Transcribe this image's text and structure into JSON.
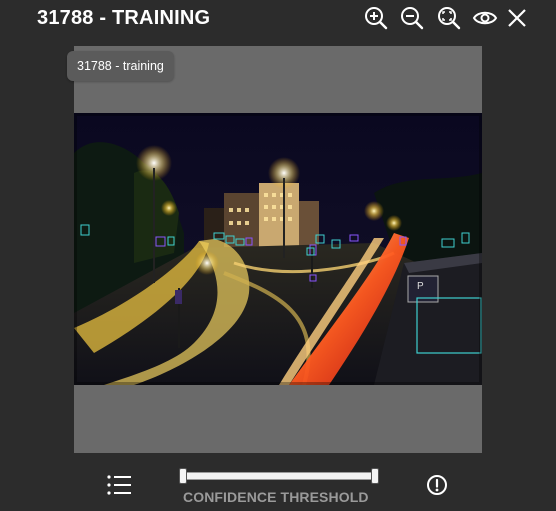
{
  "header": {
    "title": "31788 - TRAINING"
  },
  "toolbar": {
    "icons": [
      "zoom-in-icon",
      "zoom-out-icon",
      "zoom-reset-icon",
      "eye-icon",
      "close-icon"
    ]
  },
  "image": {
    "tooltip": "31788 - training"
  },
  "controls": {
    "slider_label": "CONFIDENCE THRESHOLD",
    "slider_low": 0,
    "slider_high": 1,
    "list_icon": "list-icon",
    "alert_icon": "alert-icon"
  },
  "colors": {
    "background": "#2c2c2c",
    "panel": "#6a6a6a",
    "detection_box_cyan": "#3fd0d0",
    "detection_box_purple": "#8a55ff",
    "label_gray": "#9a9a9a"
  }
}
